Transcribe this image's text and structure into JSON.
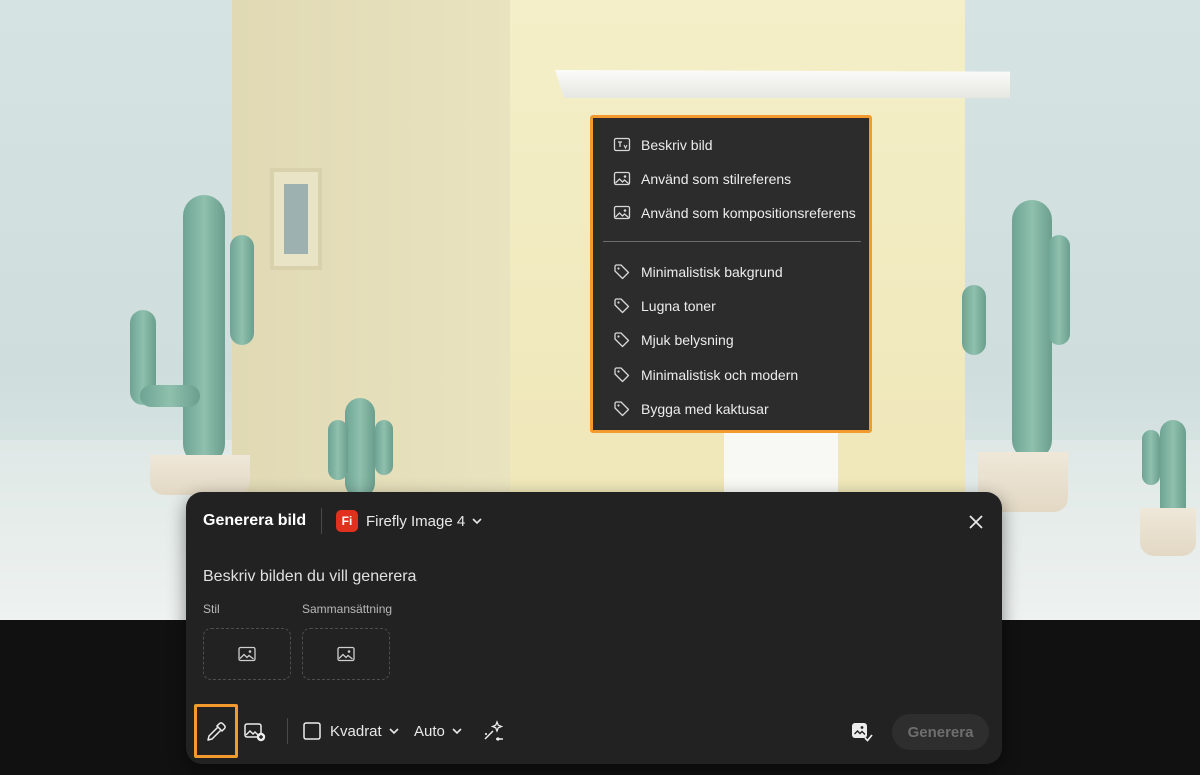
{
  "context_menu": {
    "items": [
      {
        "label": "Beskriv bild",
        "icon": "describe-image-icon"
      },
      {
        "label": "Använd som stilreferens",
        "icon": "image-icon"
      },
      {
        "label": "Använd som kompositionsreferens",
        "icon": "image-icon"
      }
    ],
    "suggestions": [
      {
        "label": "Minimalistisk bakgrund",
        "icon": "tag-icon"
      },
      {
        "label": "Lugna toner",
        "icon": "tag-icon"
      },
      {
        "label": "Mjuk belysning",
        "icon": "tag-icon"
      },
      {
        "label": "Minimalistisk och modern",
        "icon": "tag-icon"
      },
      {
        "label": "Bygga med kaktusar",
        "icon": "tag-icon"
      }
    ]
  },
  "panel": {
    "title": "Generera bild",
    "model": {
      "logo": "Fi",
      "name": "Firefly Image 4"
    },
    "prompt_placeholder": "Beskriv bilden du vill generera",
    "style_label": "Stil",
    "composition_label": "Sammansättning",
    "toolbar": {
      "aspect": "Kvadrat",
      "quality": "Auto",
      "generate": "Generera"
    }
  },
  "colors": {
    "highlight": "#f29a2e",
    "panel_bg": "#222222",
    "menu_bg": "#2c2c2c",
    "firefly_red": "#e0301e"
  }
}
